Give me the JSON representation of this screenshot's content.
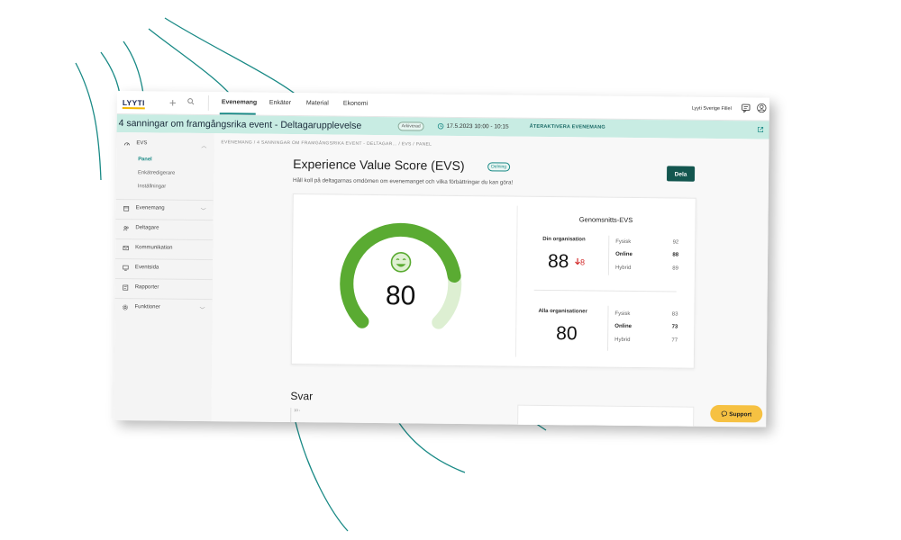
{
  "app": {
    "logo": "LYYTI",
    "nav": [
      "Evenemang",
      "Enkäter",
      "Material",
      "Ekonomi"
    ],
    "active_nav": "Evenemang",
    "org_name": "Lyyti Sverige Fillel",
    "icons": [
      "plus-icon",
      "search-icon",
      "chat-icon",
      "user-icon"
    ]
  },
  "event": {
    "title": "4 sanningar om framgångsrika event - Deltagarupplevelse",
    "status": "Arkiverad",
    "date": "17.5.2023 10:00 - 10:15",
    "reactivate": "ÅTERAKTIVERA EVENEMANG"
  },
  "sidebar": {
    "sections": [
      {
        "label": "EVS",
        "icon": "evs-icon",
        "expanded": true,
        "children": [
          "Panel",
          "Enkätredigerare",
          "Inställningar"
        ]
      },
      {
        "label": "Evenemang",
        "icon": "calendar-icon",
        "expandable": true
      },
      {
        "label": "Deltagare",
        "icon": "people-icon"
      },
      {
        "label": "Kommunikation",
        "icon": "mail-icon"
      },
      {
        "label": "Eventsida",
        "icon": "monitor-icon"
      },
      {
        "label": "Rapporter",
        "icon": "report-icon"
      },
      {
        "label": "Funktioner",
        "icon": "gear-icon",
        "expandable": true
      }
    ],
    "active_item": "Panel"
  },
  "breadcrumb": "EVENEMANG  /  4 SANNINGAR OM FRAMGÅNGSRIKA EVENT - DELTAGAR...  /  EVS  /  PANEL",
  "page": {
    "title": "Experience Value Score (EVS)",
    "badge": "Delning",
    "subtitle": "Håll koll på deltagarnas omdömen om evenemanget och vilka förbättringar du kan göra!",
    "share_button": "Dela"
  },
  "score": {
    "value": "80",
    "gauge_fraction": 0.8,
    "colors": {
      "fill": "#5aab32",
      "track": "#ddefd2"
    }
  },
  "average": {
    "title": "Genomsnitts-EVS",
    "your_org": {
      "label": "Din organisation",
      "value": "88",
      "delta": "8",
      "rows": [
        {
          "label": "Fysisk",
          "value": "92",
          "bold": false
        },
        {
          "label": "Online",
          "value": "88",
          "bold": true
        },
        {
          "label": "Hybrid",
          "value": "89",
          "bold": false
        }
      ]
    },
    "all_orgs": {
      "label": "Alla organisationer",
      "value": "80",
      "rows": [
        {
          "label": "Fysisk",
          "value": "83",
          "bold": false
        },
        {
          "label": "Online",
          "value": "73",
          "bold": true
        },
        {
          "label": "Hybrid",
          "value": "77",
          "bold": false
        }
      ]
    }
  },
  "answers": {
    "title": "Svar",
    "axis_top": "10 -"
  },
  "support_button": "Support",
  "colors": {
    "accent": "#1a8a86",
    "event_bar": "#c8ece3",
    "share_button": "#13564f",
    "support": "#f6c142",
    "delta": "#d32f2f"
  }
}
